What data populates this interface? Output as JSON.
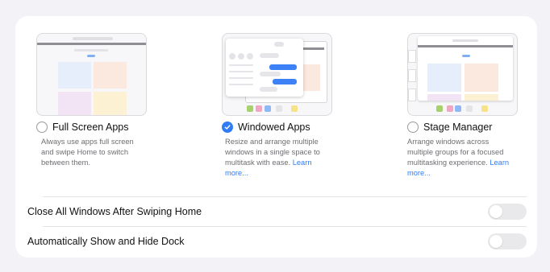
{
  "options": [
    {
      "label": "Full Screen Apps",
      "selected": false,
      "description": "Always use apps full screen and swipe Home to switch between them.",
      "link": ""
    },
    {
      "label": "Windowed Apps",
      "selected": true,
      "description": "Resize and arrange multiple windows in a single space to multitask with ease.",
      "link": "Learn more..."
    },
    {
      "label": "Stage Manager",
      "selected": false,
      "description": "Arrange windows across multiple groups for a focused multitasking experience.",
      "link": "Learn more..."
    }
  ],
  "settings": [
    {
      "label": "Close All Windows After Swiping Home",
      "enabled": false
    },
    {
      "label": "Automatically Show and Hide Dock",
      "enabled": false
    }
  ],
  "colors": {
    "accent": "#2f7cf6",
    "toggle_off": "#e9e9eb",
    "background": "#f2f2f7"
  }
}
